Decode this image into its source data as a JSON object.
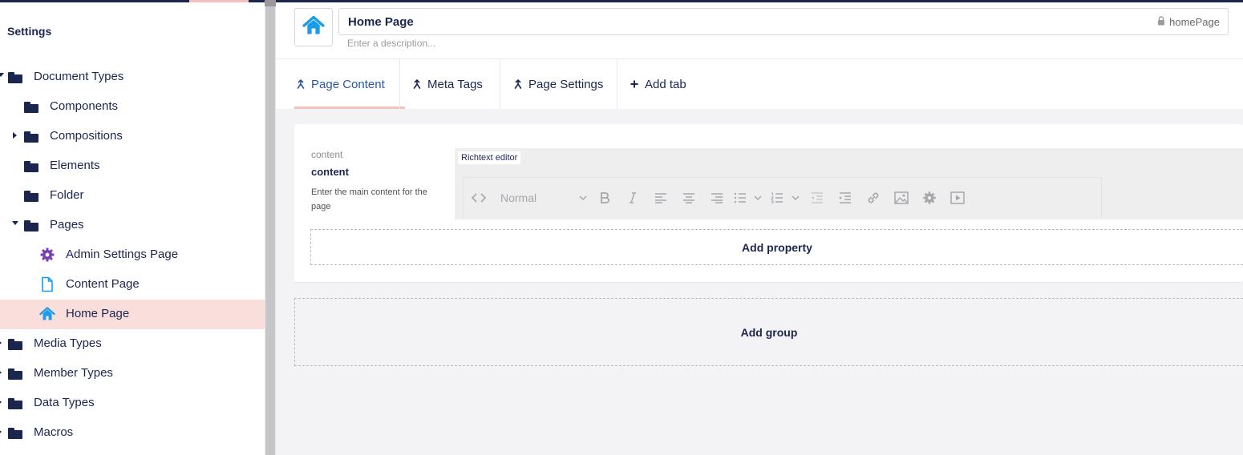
{
  "sidebar": {
    "title": "Settings",
    "items": [
      {
        "label": "Document Types",
        "icon": "folder-icon",
        "caret": "down"
      },
      {
        "label": "Components",
        "icon": "folder-icon",
        "caret": ""
      },
      {
        "label": "Compositions",
        "icon": "folder-icon",
        "caret": "right"
      },
      {
        "label": "Elements",
        "icon": "folder-icon",
        "caret": ""
      },
      {
        "label": "Folder",
        "icon": "folder-icon",
        "caret": ""
      },
      {
        "label": "Pages",
        "icon": "folder-icon",
        "caret": "down"
      },
      {
        "label": "Admin Settings Page",
        "icon": "gear-icon",
        "caret": ""
      },
      {
        "label": "Content Page",
        "icon": "document-icon",
        "caret": ""
      },
      {
        "label": "Home Page",
        "icon": "home-icon",
        "caret": "",
        "active": true
      },
      {
        "label": "Media Types",
        "icon": "folder-icon",
        "caret": "right"
      },
      {
        "label": "Member Types",
        "icon": "folder-icon",
        "caret": "right"
      },
      {
        "label": "Data Types",
        "icon": "folder-icon",
        "caret": "right"
      },
      {
        "label": "Macros",
        "icon": "folder-icon",
        "caret": "right"
      }
    ]
  },
  "header": {
    "icon": "home-icon",
    "name": "Home Page",
    "alias": "homePage",
    "description_placeholder": "Enter a description..."
  },
  "tabs": [
    {
      "label": "Page Content",
      "icon": "drag-handle-icon",
      "active": true
    },
    {
      "label": "Meta Tags",
      "icon": "drag-handle-icon"
    },
    {
      "label": "Page Settings",
      "icon": "drag-handle-icon"
    },
    {
      "label": "Add tab",
      "icon": "plus-icon"
    }
  ],
  "group": {
    "property": {
      "alias": "content",
      "name": "content",
      "description": "Enter the main content for the page",
      "editor_label": "Richtext editor",
      "format_select": "Normal"
    },
    "add_property_label": "Add property"
  },
  "add_group_label": "Add group",
  "colors": {
    "navy": "#1b264f",
    "accent_pink": "#f5c1bc",
    "active_row": "#f9dedb",
    "home_icon_blue": "#1a9ce6",
    "gear_purple": "#7a3fb0",
    "active_tab": "#2b56a6"
  }
}
